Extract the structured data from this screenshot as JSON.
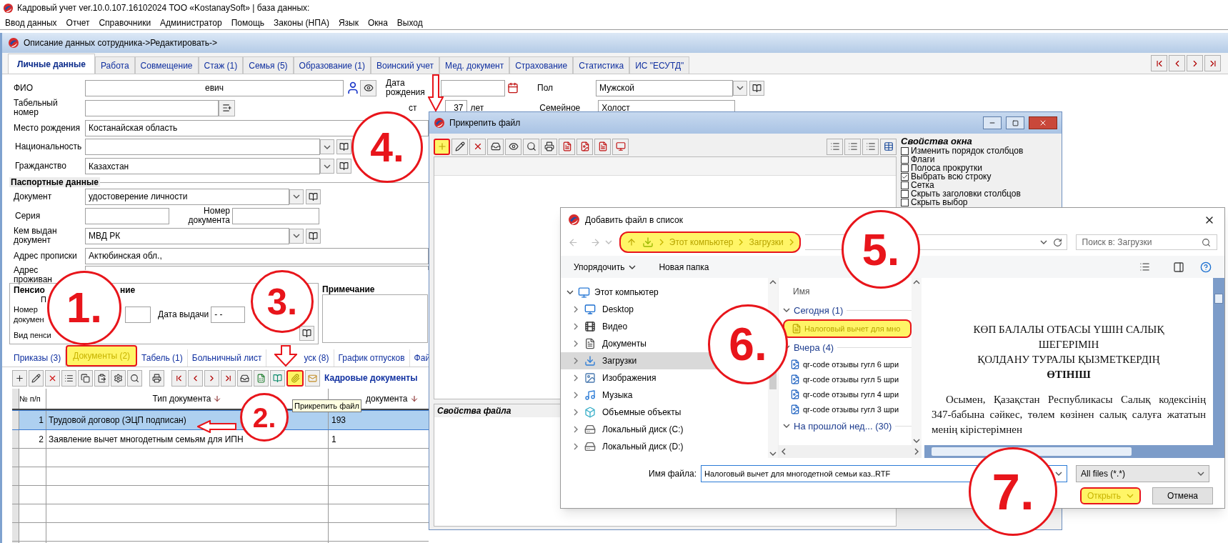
{
  "window": {
    "title": "Кадровый учет ver.10.0.107.16102024 ТОО «KostanaySoft» | база данных:"
  },
  "menu": [
    "Ввод данных",
    "Отчет",
    "Справочники",
    "Администратор",
    "Помощь",
    "Законы (НПА)",
    "Язык",
    "Окна",
    "Выход"
  ],
  "employee_window": {
    "title": "Описание данных сотрудника->Редактировать->",
    "tabs": [
      {
        "label": "Личные данные",
        "selected": true
      },
      {
        "label": "Работа",
        "selected": false
      },
      {
        "label": "Совмещение",
        "selected": false
      },
      {
        "label": "Стаж (1)",
        "selected": false
      },
      {
        "label": "Семья (5)",
        "selected": false
      },
      {
        "label": "Образование (1)",
        "selected": false
      },
      {
        "label": "Воинский учет",
        "selected": false
      },
      {
        "label": "Мед. документ",
        "selected": false
      },
      {
        "label": "Страхование",
        "selected": false
      },
      {
        "label": "Статистика",
        "selected": false
      },
      {
        "label": "ИС \"ЕСУТД\"",
        "selected": false
      }
    ],
    "personal": {
      "fio": {
        "label": "ФИО",
        "value": "евич"
      },
      "tab_number": {
        "label": "Табельный номер"
      },
      "birth_date": {
        "label": "Дата рождения"
      },
      "age": {
        "label_fragment": "ст",
        "value": "37",
        "unit": "лет"
      },
      "sex": {
        "label": "Пол",
        "value": "Мужской"
      },
      "marital": {
        "label": "Семейное",
        "value": "Холост"
      },
      "birthplace": {
        "label": "Место рождения",
        "value": "Костанайская область"
      },
      "nationality": {
        "label": "Национальность"
      },
      "citizenship": {
        "label": "Гражданство",
        "value": "Казахстан"
      },
      "passport": {
        "title": "Паспортные данные",
        "document": {
          "label": "Документ",
          "value": "удостоверение личности"
        },
        "series": {
          "label": "Серия"
        },
        "number": {
          "label": "Номер документа"
        },
        "issued_by": {
          "label": "Кем выдан документ",
          "value": "МВД РК"
        }
      },
      "registration_address": {
        "label": "Адрес прописки",
        "value": "Актюбинская обл.,"
      },
      "residence_address": {
        "label": "Адрес проживан"
      },
      "pension": {
        "title_start": "Пенсио",
        "title_end": "ние",
        "label_fragment": "П",
        "number_label": "Номер докумен",
        "issue_date_label": "Дата выдачи",
        "issue_date": "- -",
        "kind_label": "Вид пенси"
      },
      "note": {
        "label": "Примечание"
      }
    },
    "bottom_tabs": [
      {
        "label": "Приказы (3)",
        "selected": false,
        "highlighted": false
      },
      {
        "label": "Документы (2)",
        "selected": true,
        "highlighted": true
      },
      {
        "label": "Табель (1)",
        "selected": false,
        "highlighted": false
      },
      {
        "label": "Больничный лист",
        "selected": false,
        "highlighted": false
      },
      {
        "label": "уск (8)",
        "selected": false,
        "highlighted": false
      },
      {
        "label": "График отпусков",
        "selected": false,
        "highlighted": false
      },
      {
        "label": "Фай",
        "selected": false,
        "highlighted": false
      }
    ],
    "documents_toolbar": {
      "title": "Кадровые документы",
      "attach_button": {
        "highlighted": true,
        "tooltip": "Прикрепить файл"
      }
    },
    "documents_table": {
      "columns": [
        "№ п/п",
        "Тип документа",
        "документа"
      ],
      "rows": [
        {
          "cells": [
            "1",
            "Трудовой договор (ЭЦП подписан)",
            "193"
          ],
          "selected": true
        },
        {
          "cells": [
            "2",
            "Заявление вычет многодетным семьям для ИПН",
            "1"
          ],
          "selected": false
        }
      ]
    }
  },
  "attach_dialog": {
    "title": "Прикрепить файл",
    "add_button": {
      "highlighted": true
    },
    "window_properties": {
      "title": "Свойства окна",
      "options": [
        {
          "label": "Изменить порядок столбцов",
          "checked": false
        },
        {
          "label": "Флаги",
          "checked": false
        },
        {
          "label": "Полоса прокрутки",
          "checked": false
        },
        {
          "label": "Выбрать всю строку",
          "checked": true
        },
        {
          "label": "Сетка",
          "checked": false
        },
        {
          "label": "Скрыть заголовки столбцов",
          "checked": false
        },
        {
          "label": "Скрыть выбор",
          "checked": false
        }
      ]
    },
    "file_properties": {
      "title": "Свойства файла"
    }
  },
  "add_file_dialog": {
    "title": "Добавить файл в список",
    "breadcrumb": {
      "highlighted": true,
      "parts": [
        "Этот компьютер",
        "Загрузки"
      ]
    },
    "search": {
      "placeholder": "Поиск в: Загрузки"
    },
    "commands": [
      "Упорядочить",
      "Новая папка"
    ],
    "tree": [
      {
        "label": "Этот компьютер",
        "kind": "computer",
        "expanded": true,
        "selected": false,
        "children": [
          {
            "label": "Desktop",
            "kind": "desktop",
            "expanded": false,
            "selected": false
          },
          {
            "label": "Видео",
            "kind": "video",
            "expanded": false,
            "selected": false
          },
          {
            "label": "Документы",
            "kind": "documents",
            "expanded": false,
            "selected": false
          },
          {
            "label": "Загрузки",
            "kind": "downloads",
            "expanded": false,
            "selected": true
          },
          {
            "label": "Изображения",
            "kind": "images",
            "expanded": false,
            "selected": false
          },
          {
            "label": "Музыка",
            "kind": "music",
            "expanded": false,
            "selected": false
          },
          {
            "label": "Объемные объекты",
            "kind": "objects",
            "expanded": false,
            "selected": false
          },
          {
            "label": "Локальный диск (C:)",
            "kind": "disk",
            "expanded": false,
            "selected": false
          },
          {
            "label": "Локальный диск (D:)",
            "kind": "disk",
            "expanded": false,
            "selected": false
          }
        ]
      }
    ],
    "file_list": {
      "column": "Имя",
      "groups": [
        {
          "label": "Сегодня (1)",
          "expanded": true,
          "files": [
            {
              "name": "Налоговый вычет для мно",
              "kind": "document",
              "highlighted": true
            }
          ]
        },
        {
          "label": "Вчера (4)",
          "expanded": true,
          "files": [
            {
              "name": "qr-code отзывы гугл 6 шри",
              "kind": "image",
              "highlighted": false
            },
            {
              "name": "qr-code отзывы гугл 5 шри",
              "kind": "image",
              "highlighted": false
            },
            {
              "name": "qr-code отзывы гугл 4 шри",
              "kind": "image",
              "highlighted": false
            },
            {
              "name": "qr-code отзывы гугл 3 шри",
              "kind": "image",
              "highlighted": false
            }
          ]
        },
        {
          "label": "На прошлой нед... (30)",
          "expanded": true
        }
      ]
    },
    "preview": {
      "title_lines": [
        "КӨП БАЛАЛЫ ОТБАСЫ ҮШІН САЛЫҚ ШЕГЕРІМІН",
        "ҚОЛДАНУ ТУРАЛЫ ҚЫЗМЕТКЕРДІҢ"
      ],
      "title_bold": "ӨТІНІШ",
      "paragraph": "Осымен, Қазақстан Республикасы Салық кодексінің 347-бабына сәйкес, төлем көзінен салық салуға жататын менің кірістерімнен"
    },
    "file_name": {
      "label": "Имя файла:",
      "value": "Налоговый вычет для многодетной семьи каз..RTF"
    },
    "file_type": "All files (*.*)",
    "buttons": [
      {
        "label": "Открыть",
        "kind": "split",
        "highlighted": true
      },
      {
        "label": "Отмена",
        "kind": "plain",
        "highlighted": false
      }
    ]
  },
  "annotations": [
    {
      "label": "1."
    },
    {
      "label": "2."
    },
    {
      "label": "3."
    },
    {
      "label": "4."
    },
    {
      "label": "5."
    },
    {
      "label": "6."
    },
    {
      "label": "7."
    }
  ]
}
